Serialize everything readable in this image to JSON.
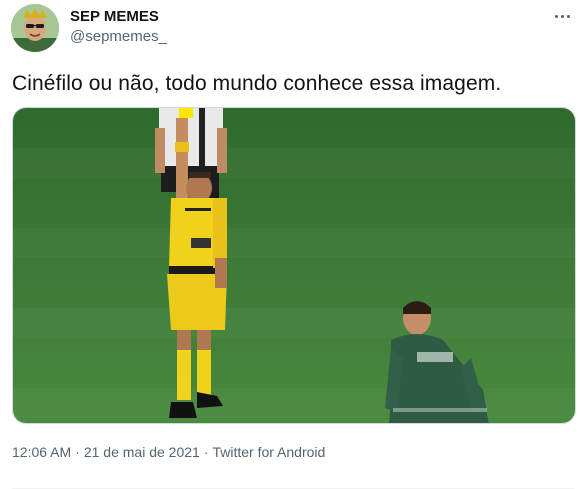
{
  "tweet": {
    "display_name": "SEP MEMES",
    "handle": "@sepmemes_",
    "text": "Cinéfilo ou não, todo mundo conhece essa imagem.",
    "time": "12:06 AM",
    "separator": "·",
    "date": "21 de mai de 2021",
    "source": "Twitter for Android"
  },
  "icons": {
    "more": "more-horizontal-icon",
    "avatar": "profile-avatar"
  },
  "colors": {
    "text_primary": "#0f1419",
    "text_secondary": "#536471",
    "pitch": "#3f7a38",
    "referee_kit": "#f0d21c",
    "card": "#ffe600",
    "palmeiras_green": "#2f5b45"
  }
}
